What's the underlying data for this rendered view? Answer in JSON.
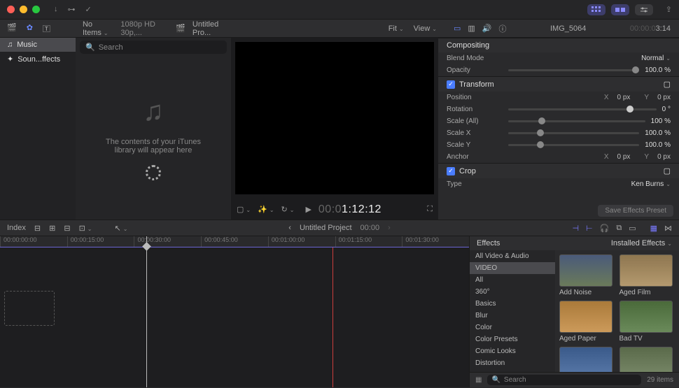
{
  "titlebar": {
    "share_icon": "share-icon"
  },
  "toolbar": {
    "no_items": "No Items",
    "format": "1080p HD 30p,...",
    "project_name": "Untitled Pro...",
    "fit": "Fit",
    "view": "View"
  },
  "inspector_header": {
    "clip_name": "IMG_5064",
    "timecode_dim": "00:00:0",
    "timecode": "3:14"
  },
  "sidebar": {
    "items": [
      {
        "label": "Music",
        "icon": "music-icon"
      },
      {
        "label": "Soun...ffects",
        "icon": "sparkle-icon"
      }
    ]
  },
  "browser": {
    "search_placeholder": "Search",
    "empty_line1": "The contents of your iTunes",
    "empty_line2": "library will appear here"
  },
  "viewer": {
    "timecode_dim": "00:0",
    "timecode": "1:12:12"
  },
  "inspector": {
    "sections": {
      "compositing": "Compositing",
      "transform": "Transform",
      "crop": "Crop"
    },
    "rows": {
      "blend_mode": {
        "label": "Blend Mode",
        "value": "Normal"
      },
      "opacity": {
        "label": "Opacity",
        "value": "100.0 %"
      },
      "position": {
        "label": "Position",
        "x_axis": "X",
        "x_val": "0 px",
        "y_axis": "Y",
        "y_val": "0 px"
      },
      "rotation": {
        "label": "Rotation",
        "value": "0 °"
      },
      "scale_all": {
        "label": "Scale (All)",
        "value": "100 %"
      },
      "scale_x": {
        "label": "Scale X",
        "value": "100.0 %"
      },
      "scale_y": {
        "label": "Scale Y",
        "value": "100.0 %"
      },
      "anchor": {
        "label": "Anchor",
        "x_axis": "X",
        "x_val": "0 px",
        "y_axis": "Y",
        "y_val": "0 px"
      },
      "crop_type": {
        "label": "Type",
        "value": "Ken Burns"
      }
    },
    "save_btn": "Save Effects Preset"
  },
  "timeline_bar": {
    "index": "Index",
    "project": "Untitled Project",
    "time": "00:00"
  },
  "ruler": [
    "00:00:00:00",
    "00:00:15:00",
    "00:00:30:00",
    "00:00:45:00",
    "00:01:00:00",
    "00:01:15:00",
    "00:01:30:00"
  ],
  "effects": {
    "title": "Effects",
    "installed": "Installed Effects",
    "categories": [
      "All Video & Audio",
      "VIDEO",
      "All",
      "360°",
      "Basics",
      "Blur",
      "Color",
      "Color Presets",
      "Comic Looks",
      "Distortion"
    ],
    "items": [
      {
        "label": "Add Noise"
      },
      {
        "label": "Aged Film"
      },
      {
        "label": "Aged Paper"
      },
      {
        "label": "Bad TV"
      },
      {
        "label": ""
      },
      {
        "label": ""
      }
    ],
    "search_placeholder": "Search",
    "count": "29 items"
  }
}
